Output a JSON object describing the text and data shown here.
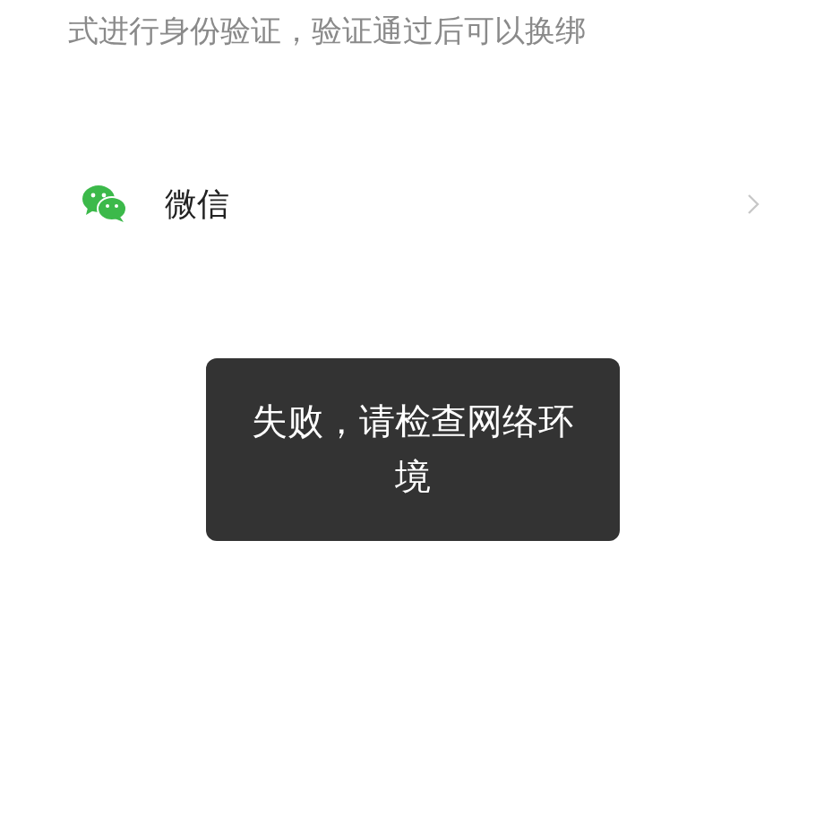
{
  "description": "式进行身份验证，验证通过后可以换绑",
  "options": [
    {
      "label": "微信"
    }
  ],
  "toast": {
    "message": "失败，请检查网络环境"
  }
}
